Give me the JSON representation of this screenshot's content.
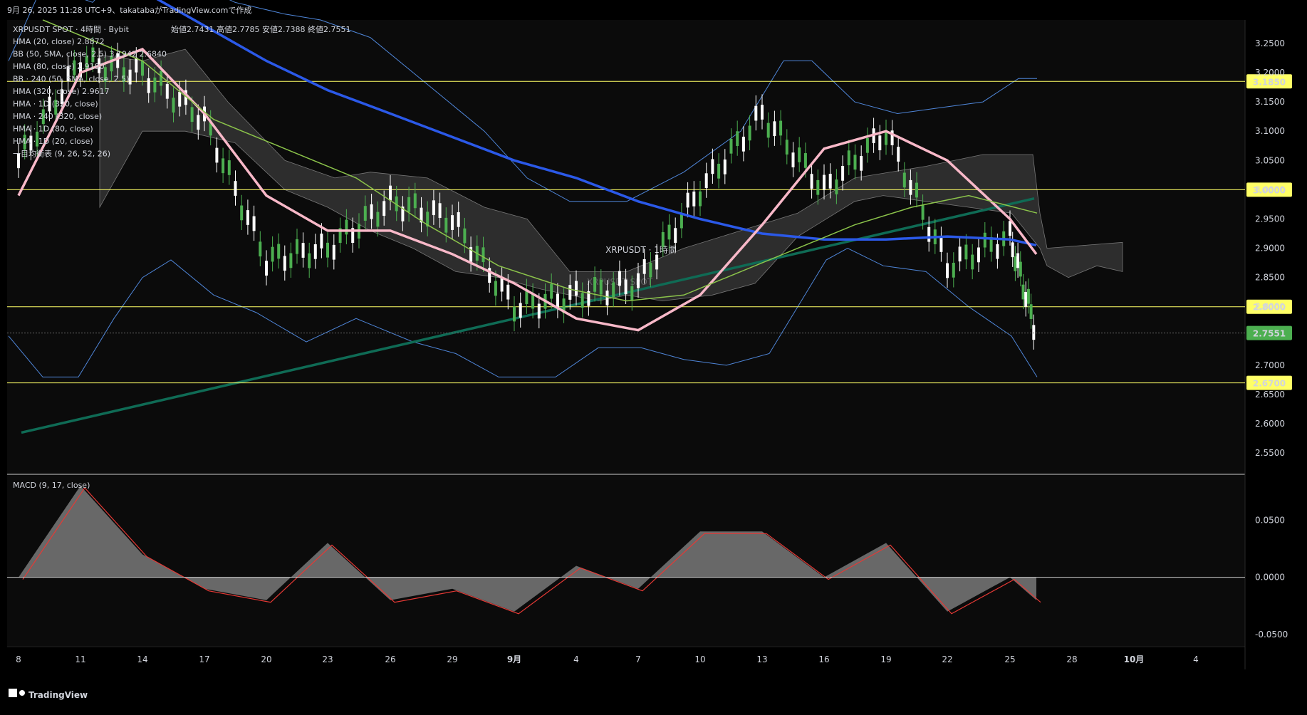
{
  "header": {
    "top_line": "9月 26, 2025 11:28 UTC+9、takatabaがTradingView.comで作成",
    "symbol_line": "XRPUSDT SPOT · 4時間 · Bybit",
    "ohlc": "始値2.7431 高値2.7785 安値2.7388 終値2.7551"
  },
  "indicators": [
    "HMA (20, close) 2.8872",
    "BB (50, SMA, close, 2.5) 3.1942 2.6840",
    "HMA (80, close) 2.9180",
    "BB · 240 (50, SMA, close, 2.5)",
    "HMA (320, close) 2.9617",
    "HMA · 1D (320, close)",
    "HMA · 240 (320, close)",
    "HMA · 1D (80, close)",
    "HMA · 1D (20, close)",
    "一目均衡表 (9, 26, 52, 26)"
  ],
  "watermark": {
    "main": "XRPUSDT · 1時間",
    "sub": "XRPUSDT SPOT"
  },
  "colors": {
    "background": "#000000",
    "bull": "#4caf50",
    "bear": "#ffffff",
    "hma20": "#c778dd",
    "hma80": "#5ca8ff",
    "hma320": "#f8b8c8",
    "bb": "#4f86d9",
    "hma1d_320": "#2b59e8",
    "hma240_320": "#8bc34a",
    "trend": "#0f6b55",
    "level": "#ffff66",
    "macd_fill": "#808080",
    "signal": "#e53935"
  },
  "price_axis": {
    "ticks": [
      "3.2500",
      "3.2000",
      "3.1500",
      "3.1000",
      "3.0500",
      "3.0000",
      "2.9500",
      "2.9000",
      "2.8500",
      "2.8000",
      "2.7500",
      "2.7000",
      "2.6500",
      "2.6000",
      "2.5500"
    ],
    "ylim": [
      2.515,
      3.29
    ]
  },
  "levels": [
    {
      "value": 3.185,
      "label": "3.1850"
    },
    {
      "value": 3.0,
      "label": "3.0000"
    },
    {
      "value": 2.8,
      "label": "2.8000"
    },
    {
      "value": 2.67,
      "label": "2.6700"
    }
  ],
  "last_price": {
    "value": 2.7551,
    "label": "2.7551"
  },
  "macd": {
    "title": "MACD (9, 17, close)",
    "ticks": [
      "0.0500",
      "0.0000",
      "-0.0500"
    ],
    "ylim": [
      -0.06,
      0.09
    ]
  },
  "time_axis": {
    "labels": [
      "8",
      "11",
      "14",
      "17",
      "20",
      "23",
      "26",
      "29",
      "9月",
      "4",
      "7",
      "10",
      "13",
      "16",
      "19",
      "22",
      "25",
      "28",
      "10月",
      "4"
    ]
  },
  "footer": {
    "brand": "TradingView"
  },
  "chart_data": {
    "type": "line",
    "title": "XRPUSDT SPOT · 4時間 · Bybit",
    "x": [
      "8",
      "11",
      "14",
      "17",
      "20",
      "23",
      "26",
      "29",
      "9月",
      "4",
      "7",
      "10",
      "13",
      "16",
      "19",
      "22",
      "25",
      "26"
    ],
    "series": [
      {
        "name": "XRPUSDT SPOT",
        "values": [
          3.05,
          3.22,
          3.2,
          3.12,
          2.88,
          2.9,
          2.98,
          2.95,
          2.8,
          2.82,
          2.84,
          3.0,
          3.13,
          3.0,
          3.1,
          2.87,
          2.92,
          2.7551
        ]
      },
      {
        "name": "HMA (320, close)",
        "values": [
          2.99,
          3.2,
          3.24,
          3.13,
          2.99,
          2.93,
          2.93,
          2.89,
          2.84,
          2.78,
          2.76,
          2.82,
          2.94,
          3.07,
          3.1,
          3.05,
          2.95,
          2.89
        ]
      },
      {
        "name": "HMA · 1D (320, close)",
        "values": [
          3.5,
          3.42,
          3.34,
          3.28,
          3.22,
          3.17,
          3.13,
          3.09,
          3.05,
          3.02,
          2.98,
          2.95,
          2.925,
          2.915,
          2.915,
          2.92,
          2.915,
          2.905
        ]
      },
      {
        "name": "MACD (9, 17, close)",
        "values": [
          0.0,
          0.08,
          0.02,
          -0.01,
          -0.02,
          0.03,
          -0.02,
          -0.01,
          -0.03,
          0.01,
          -0.01,
          0.04,
          0.04,
          0.0,
          0.03,
          -0.03,
          0.0,
          -0.02
        ]
      }
    ]
  }
}
